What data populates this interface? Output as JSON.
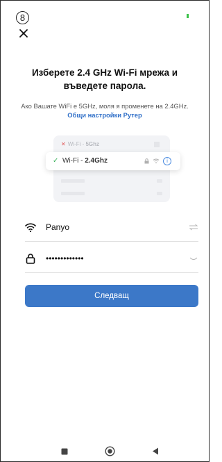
{
  "status": {
    "step_number": "8"
  },
  "title": "Изберете 2.4 GHz Wi-Fi мрежа и въведете парола.",
  "subtitle": {
    "text": "Ако Вашате WiFi е 5GHz, моля я променете на 2.4GHz.",
    "link": "Общи настройки Рутер"
  },
  "illustration": {
    "bad_network_prefix": "Wi-Fi - ",
    "bad_network_band": "5Ghz",
    "good_network_prefix": "Wi-Fi - ",
    "good_network_band": "2.4Ghz",
    "info_glyph": "i"
  },
  "form": {
    "wifi_name": "Panyo",
    "password_masked": "•••••••••••••"
  },
  "buttons": {
    "next": "Следващ"
  },
  "icons": {
    "close": "close-icon",
    "wifi": "wifi-icon",
    "lock": "lock-icon",
    "switch": "switch-network-icon",
    "eye": "eye-closed-icon"
  },
  "colors": {
    "primary": "#3c78c8",
    "link": "#2f6fc8",
    "success": "#39b25a",
    "error": "#e05555"
  }
}
